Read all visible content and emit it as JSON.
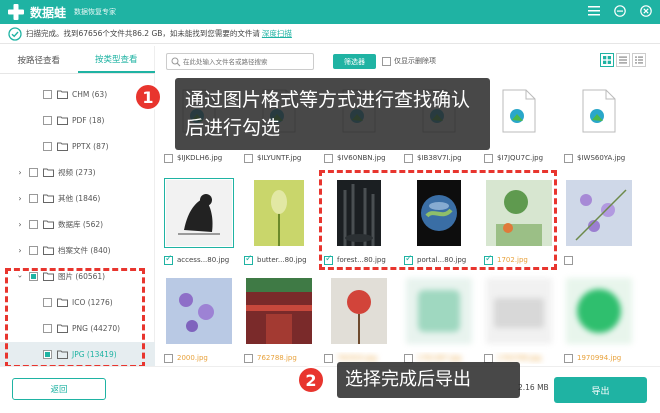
{
  "app": {
    "name": "数据蛙",
    "subtitle": "数据恢复专家",
    "icons": {
      "logo": "frog-plus-icon",
      "menu": "menu-icon",
      "minimize": "minimize-icon",
      "close": "close-icon"
    }
  },
  "status": {
    "text": "扫描完成。找到67656个文件共86.2 GB，如未能找到您需要的文件请",
    "link": "深度扫描"
  },
  "sidebar": {
    "tabs": [
      {
        "label": "按路径查看",
        "active": false
      },
      {
        "label": "按类型查看",
        "active": true
      }
    ],
    "items": [
      {
        "label": "CHM (63)"
      },
      {
        "label": "PDF (18)"
      },
      {
        "label": "PPTX (87)"
      },
      {
        "label": "视频 (273)"
      },
      {
        "label": "其他 (1846)"
      },
      {
        "label": "数据库 (562)"
      },
      {
        "label": "档案文件 (840)"
      },
      {
        "label": "图片 (60561)"
      },
      {
        "label": "ICO (1276)"
      },
      {
        "label": "PNG (44270)"
      },
      {
        "label": "JPG (13419)"
      }
    ]
  },
  "toolbar": {
    "search_placeholder": "在此处输入文件名或路径搜索",
    "filter_label": "筛选器",
    "only_deleted_label": "仅显示删除项"
  },
  "grid": {
    "items": [
      {
        "name": "$IJKDLH6.jpg"
      },
      {
        "name": "$ILYUNTF.jpg"
      },
      {
        "name": "$IV60NBN.jpg"
      },
      {
        "name": "$IB38V7I.jpg"
      },
      {
        "name": "$I7JQU7C.jpg"
      },
      {
        "name": "$IWS60YA.jpg"
      },
      {
        "name": "access...80.jpg"
      },
      {
        "name": "butter...80.jpg"
      },
      {
        "name": "forest...80.jpg"
      },
      {
        "name": "portal...80.jpg"
      },
      {
        "name": "1702.jpg"
      },
      {
        "name": ""
      },
      {
        "name": "2000.jpg"
      },
      {
        "name": "762788.jpg"
      },
      {
        "name": "762933.jpg"
      },
      {
        "name": "1761387.jpg"
      },
      {
        "name": "1763789.jpg"
      },
      {
        "name": "1970994.jpg"
      }
    ]
  },
  "callouts": {
    "step1_number": "1",
    "step1_text": "通过图片格式等方式进行查找确认后进行勾选",
    "step2_number": "2",
    "step2_text": "选择完成后导出"
  },
  "bottom": {
    "back_label": "返回",
    "size_text": "2.16 MB",
    "export_label": "导出"
  }
}
